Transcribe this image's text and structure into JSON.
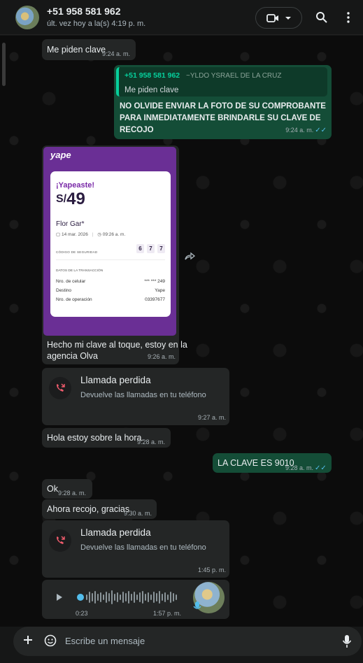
{
  "header": {
    "contact": "+51 958 581 962",
    "last_seen": "últ. vez hoy a la(s) 4:19 p. m."
  },
  "messages": {
    "m1": {
      "text": "Me piden clave",
      "time": "9:24 a. m."
    },
    "m2": {
      "quote_name": "+51 958 581 962",
      "quote_alias": "~YLDO YSRAEL DE LA CRUZ",
      "quote_text": "Me piden clave",
      "line1": "NO OLVIDE ENVIAR LA FOTO DE SU COMPROBANTE",
      "line2": "PARA INMEDIATAMENTE BRINDARLE SU CLAVE DE",
      "line3": "RECOJO",
      "time": "9:24 a. m."
    },
    "m3": {
      "yape_logo": "yape",
      "yape_title": "¡Yapeaste!",
      "yape_currency": "S/",
      "yape_amount": "49",
      "yape_name": "Flor Gar*",
      "yape_date": "14 mar. 2026",
      "yape_hour": "09:26 a. m.",
      "yape_code_label": "CÓDIGO DE SEGURIDAD",
      "yape_code": [
        "6",
        "7",
        "7"
      ],
      "yape_details_label": "DATOS DE LA TRANSACCIÓN",
      "yape_rows": [
        {
          "k": "Nro. de celular",
          "v": "*** *** 249"
        },
        {
          "k": "Destino",
          "v": "Yape"
        },
        {
          "k": "Nro. de operación",
          "v": "03397677"
        }
      ],
      "caption1": "Hecho mi clave al toque, estoy en la",
      "caption2": "agencia Olva",
      "time": "9:26 a. m."
    },
    "m4": {
      "title": "Llamada perdida",
      "sub": "Devuelve las llamadas en tu teléfono",
      "time": "9:27 a. m."
    },
    "m5": {
      "text": "Hola estoy sobre la hora.",
      "time": "9:28 a. m."
    },
    "m6": {
      "text": "LA CLAVE ES 9010",
      "time": "9:28 a. m."
    },
    "m7": {
      "text": "Ok",
      "time": "9:28 a. m."
    },
    "m8": {
      "text": "Ahora recojo, gracias",
      "time": "9:30 a. m."
    },
    "m9": {
      "title": "Llamada perdida",
      "sub": "Devuelve las llamadas en tu teléfono",
      "time": "1:45 p. m."
    },
    "m10": {
      "duration": "0:23",
      "time": "1:57 p. m."
    }
  },
  "composer": {
    "placeholder": "Escribe un mensaje"
  },
  "colors": {
    "accent": "#06cf9c",
    "outgoing": "#144d37",
    "incoming": "#242626",
    "read_ticks": "#53bdeb",
    "missed": "#f15c6d"
  }
}
